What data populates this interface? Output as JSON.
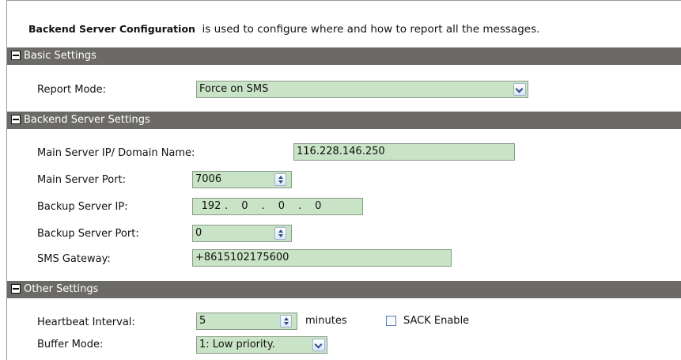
{
  "intro": {
    "bold_title": "Backend Server Configuration",
    "description": "is used to configure where and how to report all the messages."
  },
  "basic": {
    "title": "Basic Settings",
    "report_mode_label": "Report Mode:",
    "report_mode_value": "Force on SMS"
  },
  "backend": {
    "title": "Backend Server Settings",
    "main_ip_label": "Main Server IP/ Domain Name:",
    "main_ip_value": "116.228.146.250",
    "main_port_label": "Main Server Port:",
    "main_port_value": "7006",
    "backup_ip_label": "Backup Server IP:",
    "backup_ip_parts": [
      "192",
      "0",
      "0",
      "0"
    ],
    "backup_port_label": "Backup Server Port:",
    "backup_port_value": "0",
    "sms_gateway_label": "SMS Gateway:",
    "sms_gateway_value": "+8615102175600"
  },
  "other": {
    "title": "Other Settings",
    "heartbeat_label": "Heartbeat Interval:",
    "heartbeat_value": "5",
    "heartbeat_unit": "minutes",
    "sack_label": "SACK Enable",
    "sack_checked": false,
    "buffer_label": "Buffer Mode:",
    "buffer_value": "1: Low priority."
  },
  "colors": {
    "section_bar": "#6b6a66",
    "field_bg": "#c8e3c6"
  }
}
